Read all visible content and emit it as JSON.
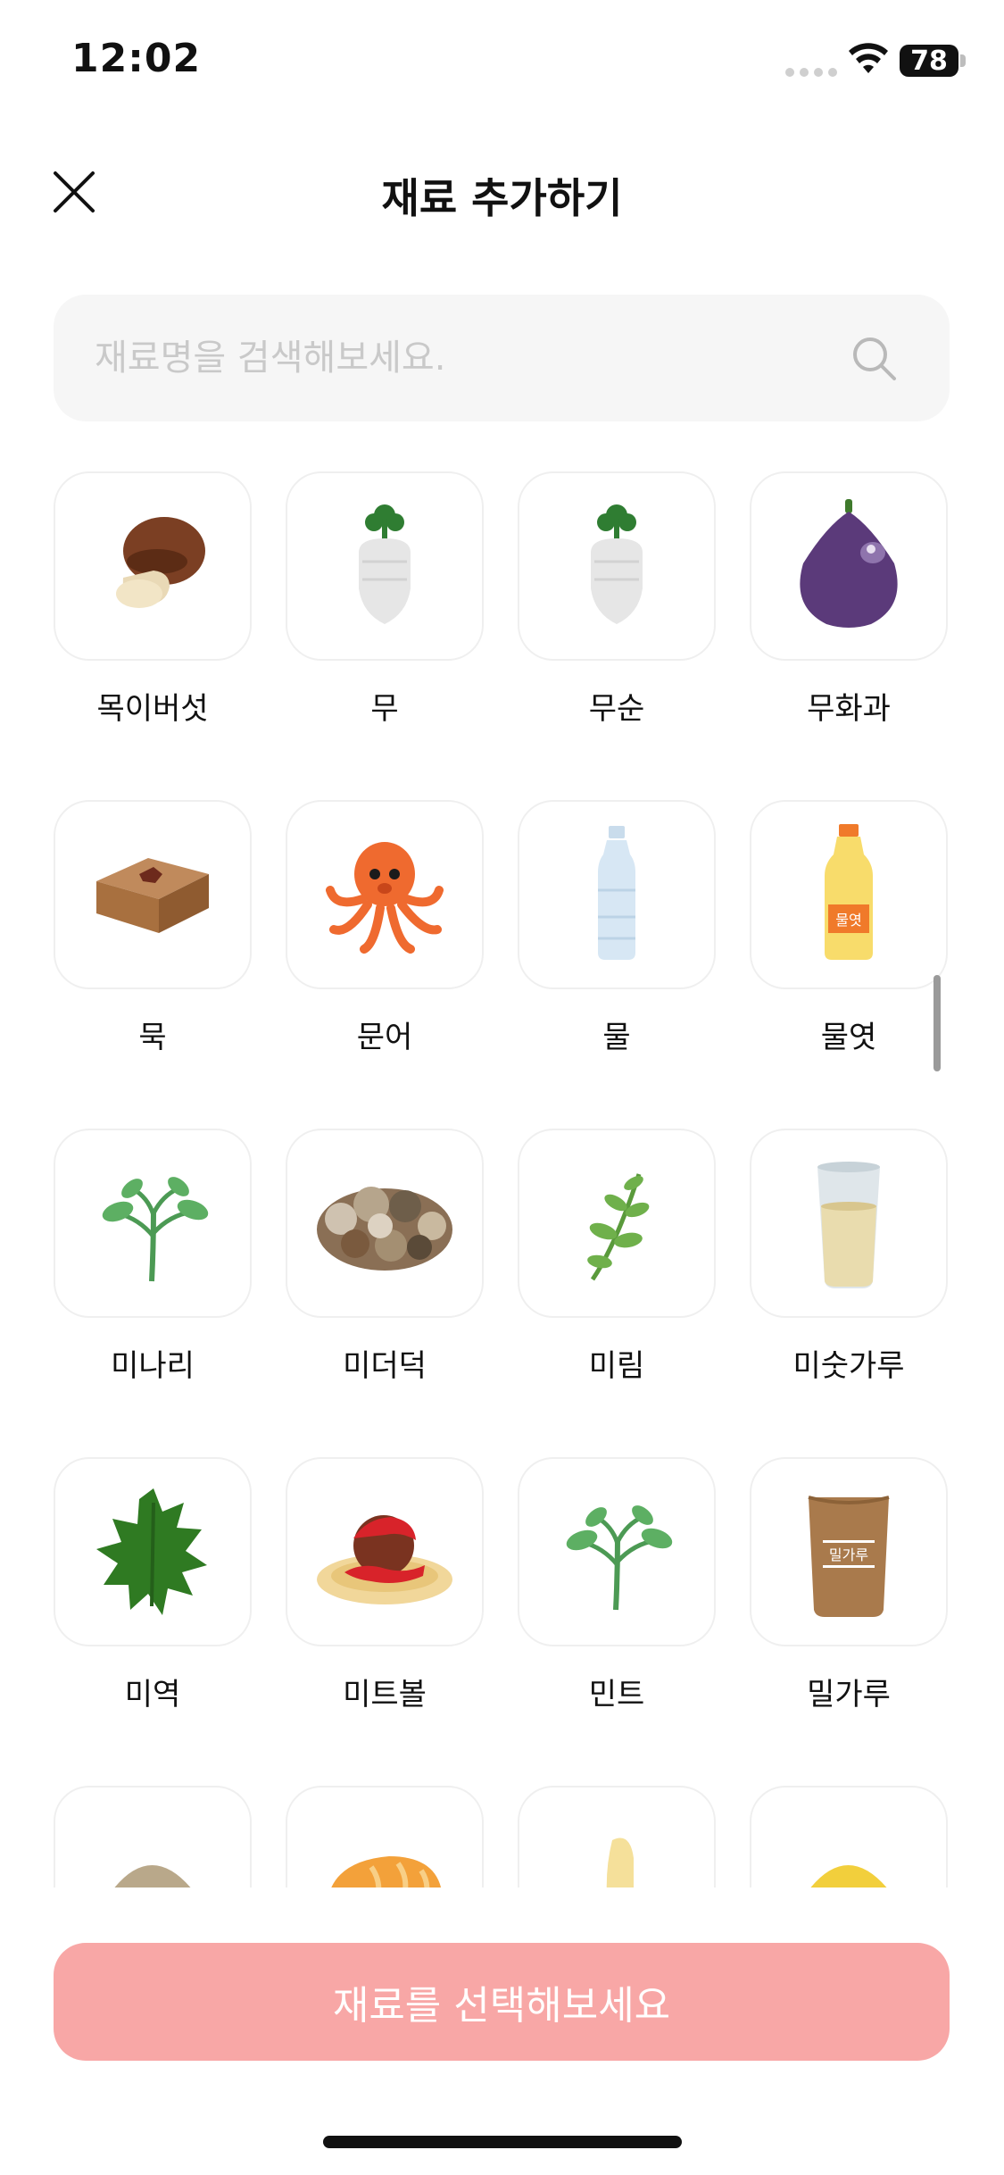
{
  "status_bar": {
    "time": "12:02",
    "battery": "78"
  },
  "header": {
    "title": "재료 추가하기"
  },
  "search": {
    "placeholder": "재료명을 검색해보세요."
  },
  "ingredients": [
    {
      "label": "목이버섯",
      "icon": "mushroom-icon"
    },
    {
      "label": "무",
      "icon": "radish-icon"
    },
    {
      "label": "무순",
      "icon": "radish-sprout-icon"
    },
    {
      "label": "무화과",
      "icon": "fig-icon"
    },
    {
      "label": "묵",
      "icon": "jelly-block-icon"
    },
    {
      "label": "문어",
      "icon": "octopus-icon"
    },
    {
      "label": "물",
      "icon": "water-bottle-icon"
    },
    {
      "label": "물엿",
      "icon": "syrup-bottle-icon",
      "tag": "물엿"
    },
    {
      "label": "미나리",
      "icon": "water-parsley-icon"
    },
    {
      "label": "미더덕",
      "icon": "sea-squirt-icon"
    },
    {
      "label": "미림",
      "icon": "herb-sprig-icon"
    },
    {
      "label": "미숫가루",
      "icon": "grain-drink-icon"
    },
    {
      "label": "미역",
      "icon": "seaweed-icon"
    },
    {
      "label": "미트볼",
      "icon": "meatball-icon"
    },
    {
      "label": "민트",
      "icon": "mint-icon"
    },
    {
      "label": "밀가루",
      "icon": "flour-bag-icon",
      "tag": "밀가루"
    },
    {
      "label": "",
      "icon": "powder-bowl-icon"
    },
    {
      "label": "",
      "icon": "bread-icon"
    },
    {
      "label": "",
      "icon": "banana-icon"
    },
    {
      "label": "",
      "icon": "yellow-powder-bowl-icon"
    }
  ],
  "cta": {
    "label": "재료를 선택해보세요"
  },
  "colors": {
    "cta_bg": "#f8a7a6",
    "tile_border": "#efefef",
    "search_bg": "#f6f6f6"
  }
}
